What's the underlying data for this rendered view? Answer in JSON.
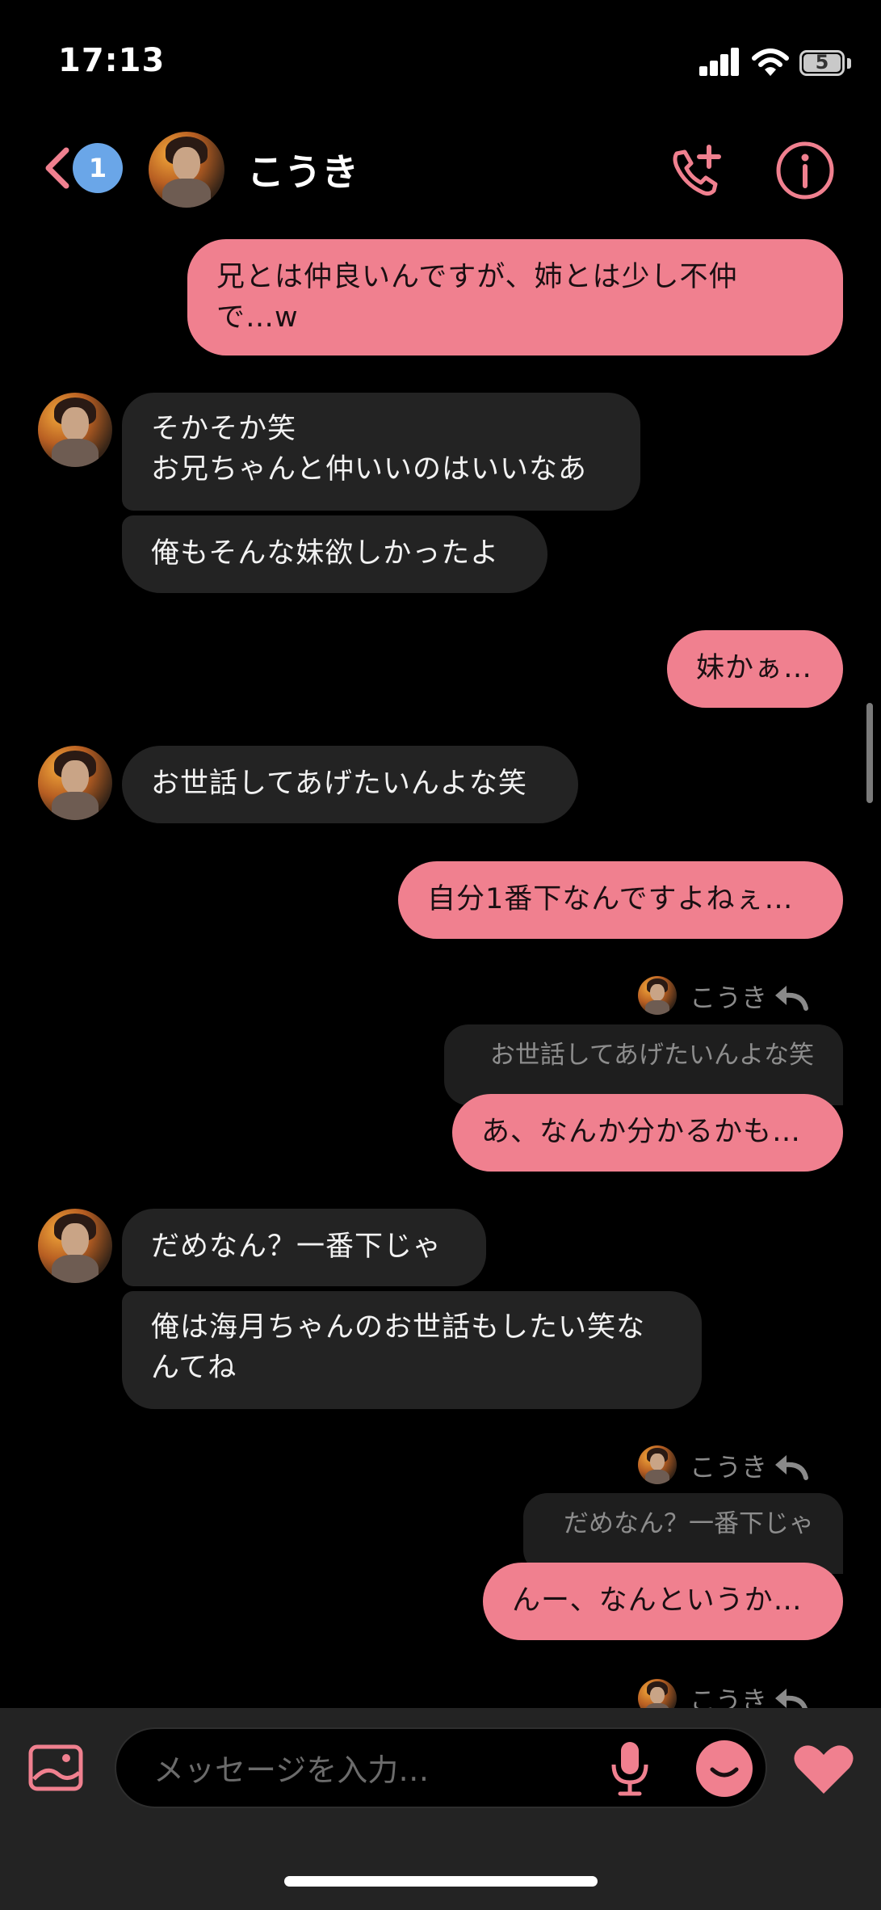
{
  "status_bar": {
    "time": "17:13",
    "battery": "5"
  },
  "header": {
    "back_badge": "1",
    "name": "こうき"
  },
  "messages": {
    "m1": "兄とは仲良いんですが、姉とは少し不仲\nで…w",
    "m2": "そかそか笑\nお兄ちゃんと仲いいのはいいなあ",
    "m3": "俺もそんな妹欲しかったよ",
    "m4": "妹かぁ…",
    "m5": "お世話してあげたいんよな笑",
    "m6": "自分1番下なんですよねぇ…",
    "r1_name": "こうき",
    "r1_quote": "お世話してあげたいんよな笑",
    "m7": "あ、なんか分かるかも…",
    "m8": "だめなん？一番下じゃ",
    "m9": "俺は海月ちゃんのお世話もしたい笑な\nんてね",
    "r2_name": "こうき",
    "r2_quote": "だめなん？一番下じゃ",
    "m10": "んー、なんというか…",
    "r3_name": "こうき"
  },
  "composer": {
    "placeholder": "メッセージを入力…"
  },
  "colors": {
    "accent": "#f0808f",
    "incoming": "#232323",
    "badge": "#6aa6e8"
  },
  "icons": [
    "signal-icon",
    "wifi-icon",
    "battery-icon",
    "back-chevron-icon",
    "add-call-icon",
    "info-icon",
    "reply-arrow-icon",
    "image-icon",
    "microphone-icon",
    "sticker-icon",
    "heart-icon"
  ]
}
